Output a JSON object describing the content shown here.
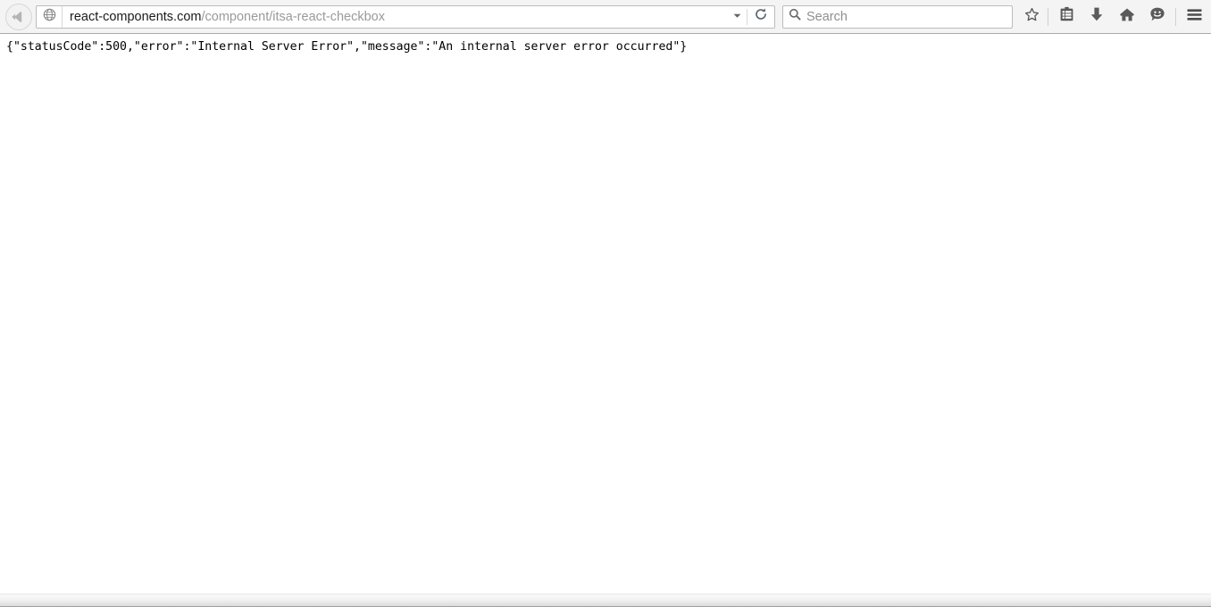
{
  "browser": {
    "navigation": {
      "back_button": {
        "icon": "arrow-left-icon",
        "tooltip": "Back"
      },
      "address_bar": {
        "icon": "globe-icon",
        "url_domain": "react-components.com",
        "url_path": "/component/itsa-react-checkbox",
        "full_url": "react-components.com/component/itsa-react-checkbox",
        "dropdown_icon": "chevron-down-icon",
        "reload_icon": "reload-icon"
      },
      "search_bar": {
        "icon": "search-icon",
        "placeholder": "Search",
        "value": ""
      },
      "toolbar_buttons": [
        {
          "name": "bookmark-star-button",
          "icon": "star-icon",
          "label": "Bookmark this page"
        },
        {
          "name": "library-button",
          "icon": "clipboard-icon",
          "label": "View history, saved bookmarks, and more"
        },
        {
          "name": "downloads-button",
          "icon": "download-arrow-icon",
          "label": "Downloads"
        },
        {
          "name": "home-button",
          "icon": "home-icon",
          "label": "Home"
        },
        {
          "name": "feedback-button",
          "icon": "chat-smiley-icon",
          "label": "Feedback"
        },
        {
          "name": "menu-button",
          "icon": "hamburger-menu-icon",
          "label": "Open menu"
        }
      ]
    },
    "page": {
      "body_text": "{\"statusCode\":500,\"error\":\"Internal Server Error\",\"message\":\"An internal server error occurred\"}",
      "status_code": 500,
      "error": "Internal Server Error",
      "message": "An internal server error occurred"
    },
    "scrollbar": {
      "orientation": "horizontal",
      "position": "bottom"
    }
  },
  "colors": {
    "toolbar_bg": "#f4f4f4",
    "toolbar_border": "#a9a9a9",
    "field_bg": "#ffffff",
    "field_border": "#bcbcbc",
    "url_domain_text": "#1a1a1a",
    "url_path_text": "#9a9a9a",
    "placeholder_text": "#8f8f8f",
    "icon_grey": "#6a6a6a",
    "page_bg": "#ffffff",
    "page_text": "#000000"
  }
}
